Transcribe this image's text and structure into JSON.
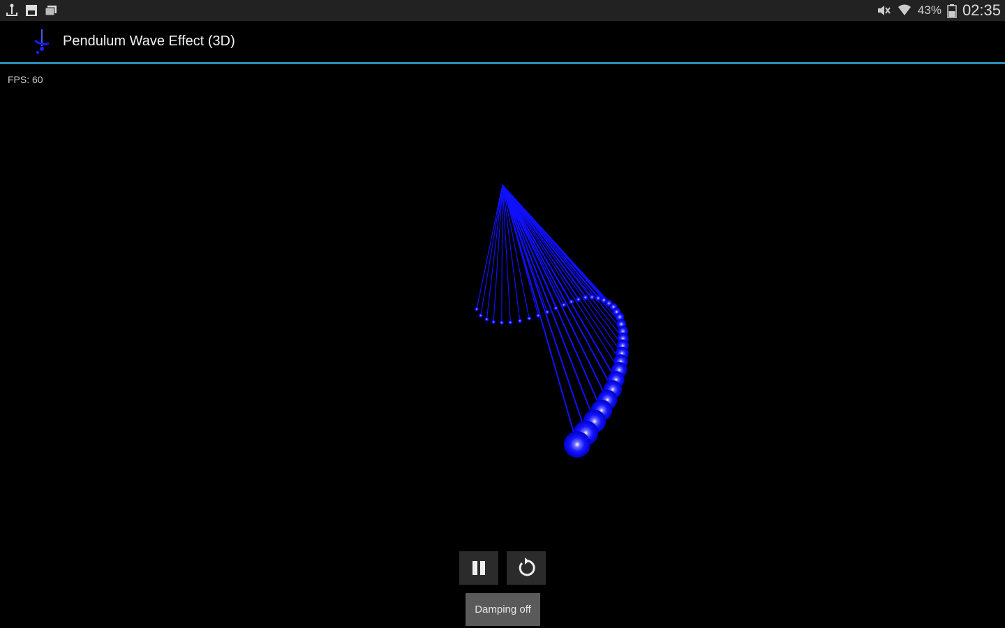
{
  "status_bar": {
    "left_icons": [
      "usb-icon",
      "sd-card-icon",
      "photos-icon"
    ],
    "right_icons": [
      "mute-icon",
      "wifi-icon",
      "battery-icon"
    ],
    "battery_percent": "43%",
    "time": "02:35"
  },
  "app_bar": {
    "title": "Pendulum Wave Effect (3D)",
    "icon": "pendulum-app-icon"
  },
  "fps_label": "FPS: 60",
  "scene": {
    "pendulum_color": "#1010ff",
    "accent_color": "#2a8fb8"
  },
  "controls": {
    "pause_icon": "pause-icon",
    "reset_icon": "reset-icon"
  },
  "toast": {
    "text": "Damping off"
  }
}
